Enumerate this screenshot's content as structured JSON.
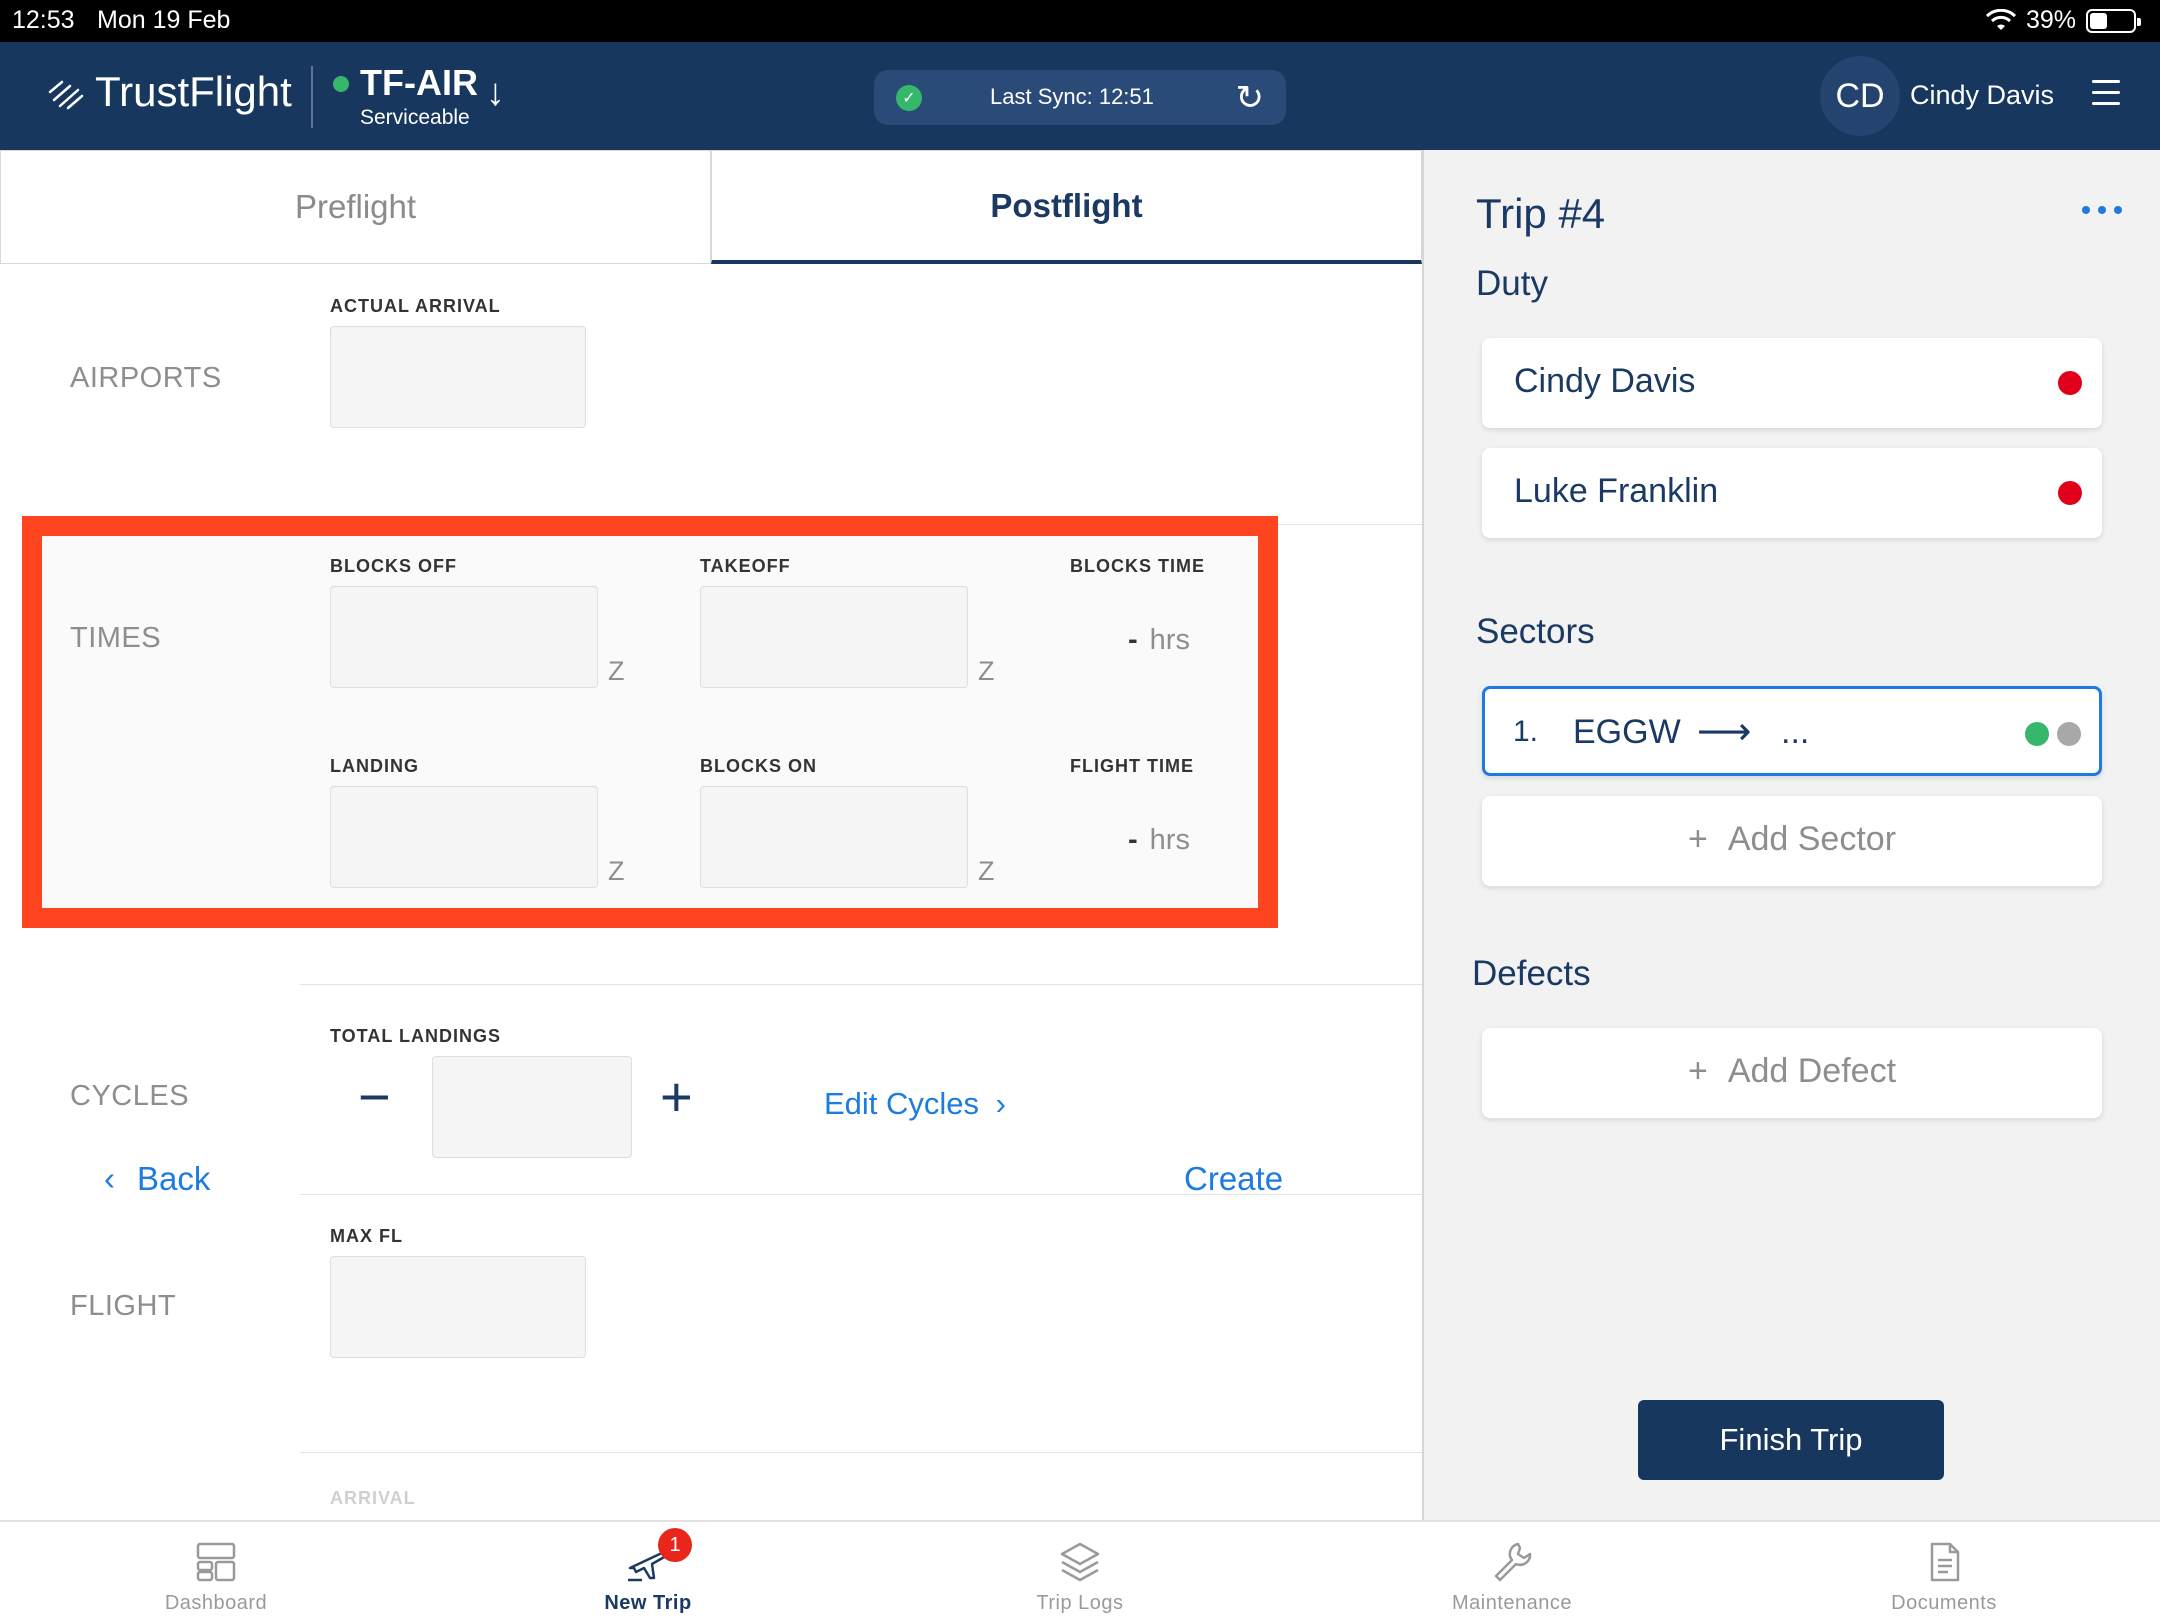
{
  "status_bar": {
    "time": "12:53",
    "date": "Mon 19 Feb",
    "battery": "39%",
    "battery_level": 0.39
  },
  "header": {
    "brand": "TrustFlight",
    "aircraft": "TF-AIR",
    "aircraft_status": "Serviceable",
    "status_color": "#35b86b",
    "sync_text": "Last Sync: 12:51",
    "user_initials": "CD",
    "user_name": "Cindy Davis"
  },
  "tabs": [
    {
      "label": "Preflight",
      "active": false
    },
    {
      "label": "Postflight",
      "active": true
    }
  ],
  "sections": {
    "airports": {
      "label": "AIRPORTS",
      "actual_arrival_label": "ACTUAL ARRIVAL",
      "actual_arrival_value": ""
    },
    "times": {
      "label": "TIMES",
      "blocks_off_label": "BLOCKS OFF",
      "takeoff_label": "TAKEOFF",
      "blocks_time_label": "BLOCKS TIME",
      "landing_label": "LANDING",
      "blocks_on_label": "BLOCKS ON",
      "flight_time_label": "FLIGHT TIME",
      "zulu_suffix": "Z",
      "dash": "-",
      "hrs": "hrs",
      "blocks_off_value": "",
      "takeoff_value": "",
      "landing_value": "",
      "blocks_on_value": ""
    },
    "cycles": {
      "label": "CYCLES",
      "total_landings_label": "TOTAL LANDINGS",
      "total_landings_value": "",
      "minus": "−",
      "plus": "+",
      "edit_cycles": "Edit Cycles"
    },
    "flight": {
      "label": "FLIGHT",
      "max_fl_label": "MAX FL",
      "max_fl_value": "",
      "arrival_label": "ARRIVAL"
    }
  },
  "footer_actions": {
    "back": "Back",
    "create": "Create"
  },
  "trip": {
    "title": "Trip #4",
    "duty_heading": "Duty",
    "crew": [
      {
        "name": "Cindy Davis",
        "status_color": "#e0001b"
      },
      {
        "name": "Luke Franklin",
        "status_color": "#e0001b"
      }
    ],
    "sectors_heading": "Sectors",
    "sectors": [
      {
        "number": "1.",
        "from": "EGGW",
        "to": "...",
        "status_colors": [
          "#35b86b",
          "#a8a8a8"
        ]
      }
    ],
    "add_sector": "Add Sector",
    "defects_heading": "Defects",
    "add_defect": "Add Defect",
    "finish_trip": "Finish Trip"
  },
  "tabbar": {
    "items": [
      {
        "label": "Dashboard",
        "icon": "dashboard-icon"
      },
      {
        "label": "New Trip",
        "icon": "new-trip-icon",
        "badge": "1"
      },
      {
        "label": "Trip Logs",
        "icon": "trip-logs-icon"
      },
      {
        "label": "Maintenance",
        "icon": "wrench-icon"
      },
      {
        "label": "Documents",
        "icon": "documents-icon"
      }
    ]
  },
  "colors": {
    "accent": "#1e7be0",
    "navy": "#17375f",
    "highlight_border": "#ff4420"
  }
}
